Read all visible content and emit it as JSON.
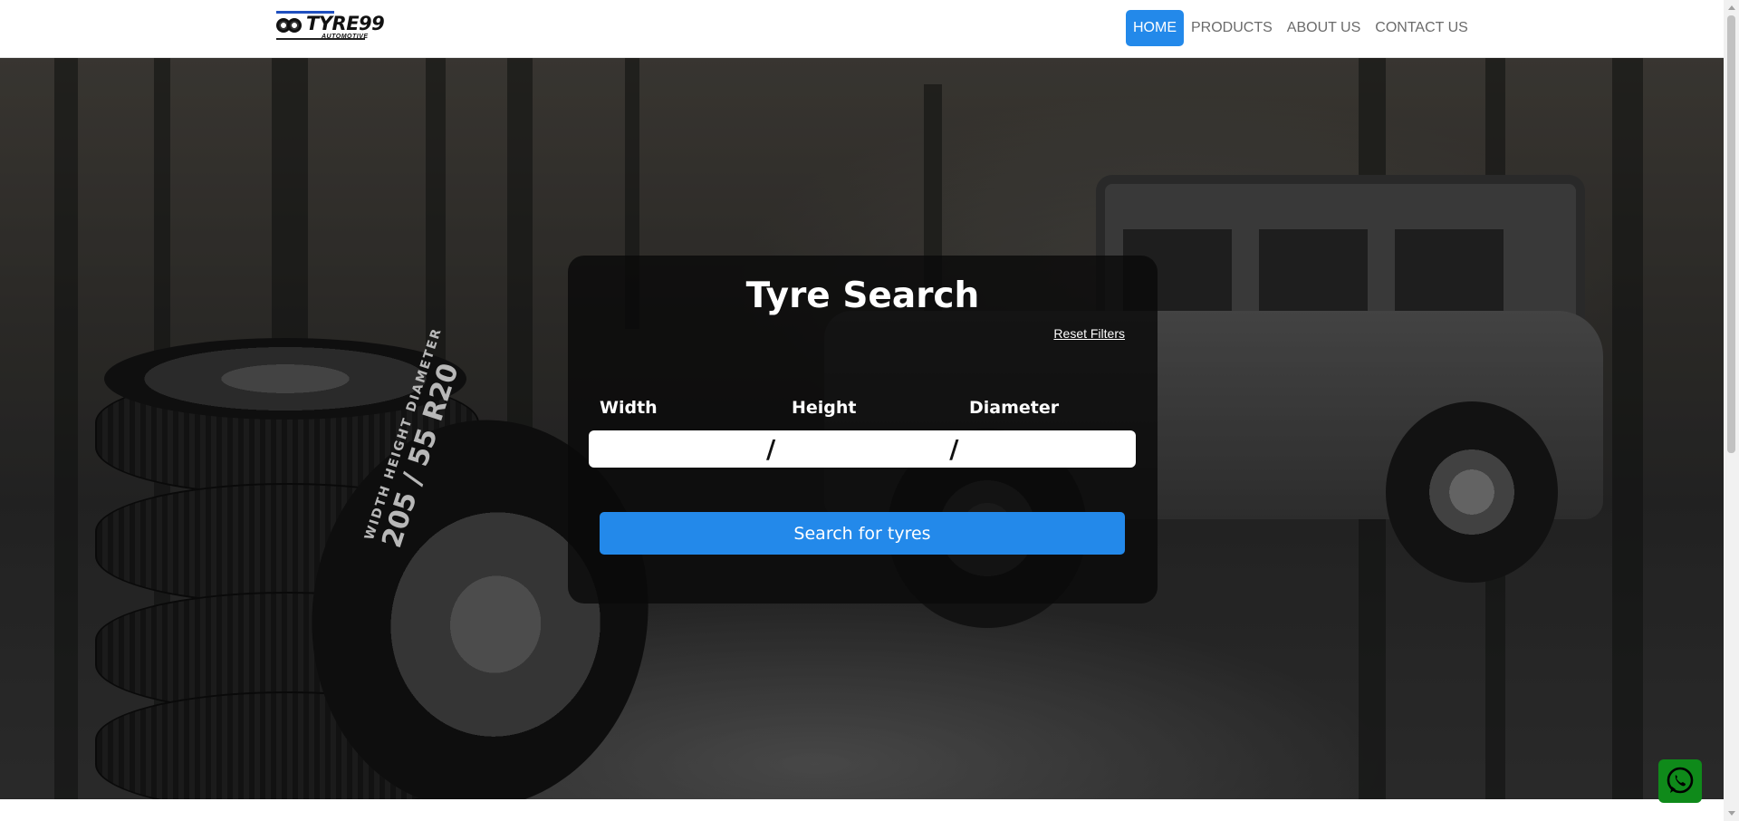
{
  "brand": {
    "name": "TYRE99",
    "sub": "AUTOMOTIVE",
    "accent": "#2389ea"
  },
  "nav": {
    "items": [
      {
        "label": "HOME",
        "active": true
      },
      {
        "label": "PRODUCTS",
        "active": false
      },
      {
        "label": "ABOUT US",
        "active": false
      },
      {
        "label": "CONTACT US",
        "active": false
      }
    ]
  },
  "hero": {
    "tyre_label_sizes": "WIDTH   HEIGHT   DIAMETER",
    "tyre_label_value": "205 / 55 R20"
  },
  "search": {
    "title": "Tyre Search",
    "reset_label": "Reset Filters",
    "width_label": "Width",
    "height_label": "Height",
    "diameter_label": "Diameter",
    "width_value": "",
    "height_value": "",
    "diameter_value": "",
    "separator": "/",
    "button_label": "Search for tyres"
  },
  "icons": {
    "whatsapp": "whatsapp-icon"
  },
  "colors": {
    "whatsapp_green": "#0f8a1a",
    "button_blue": "#2389ea"
  }
}
